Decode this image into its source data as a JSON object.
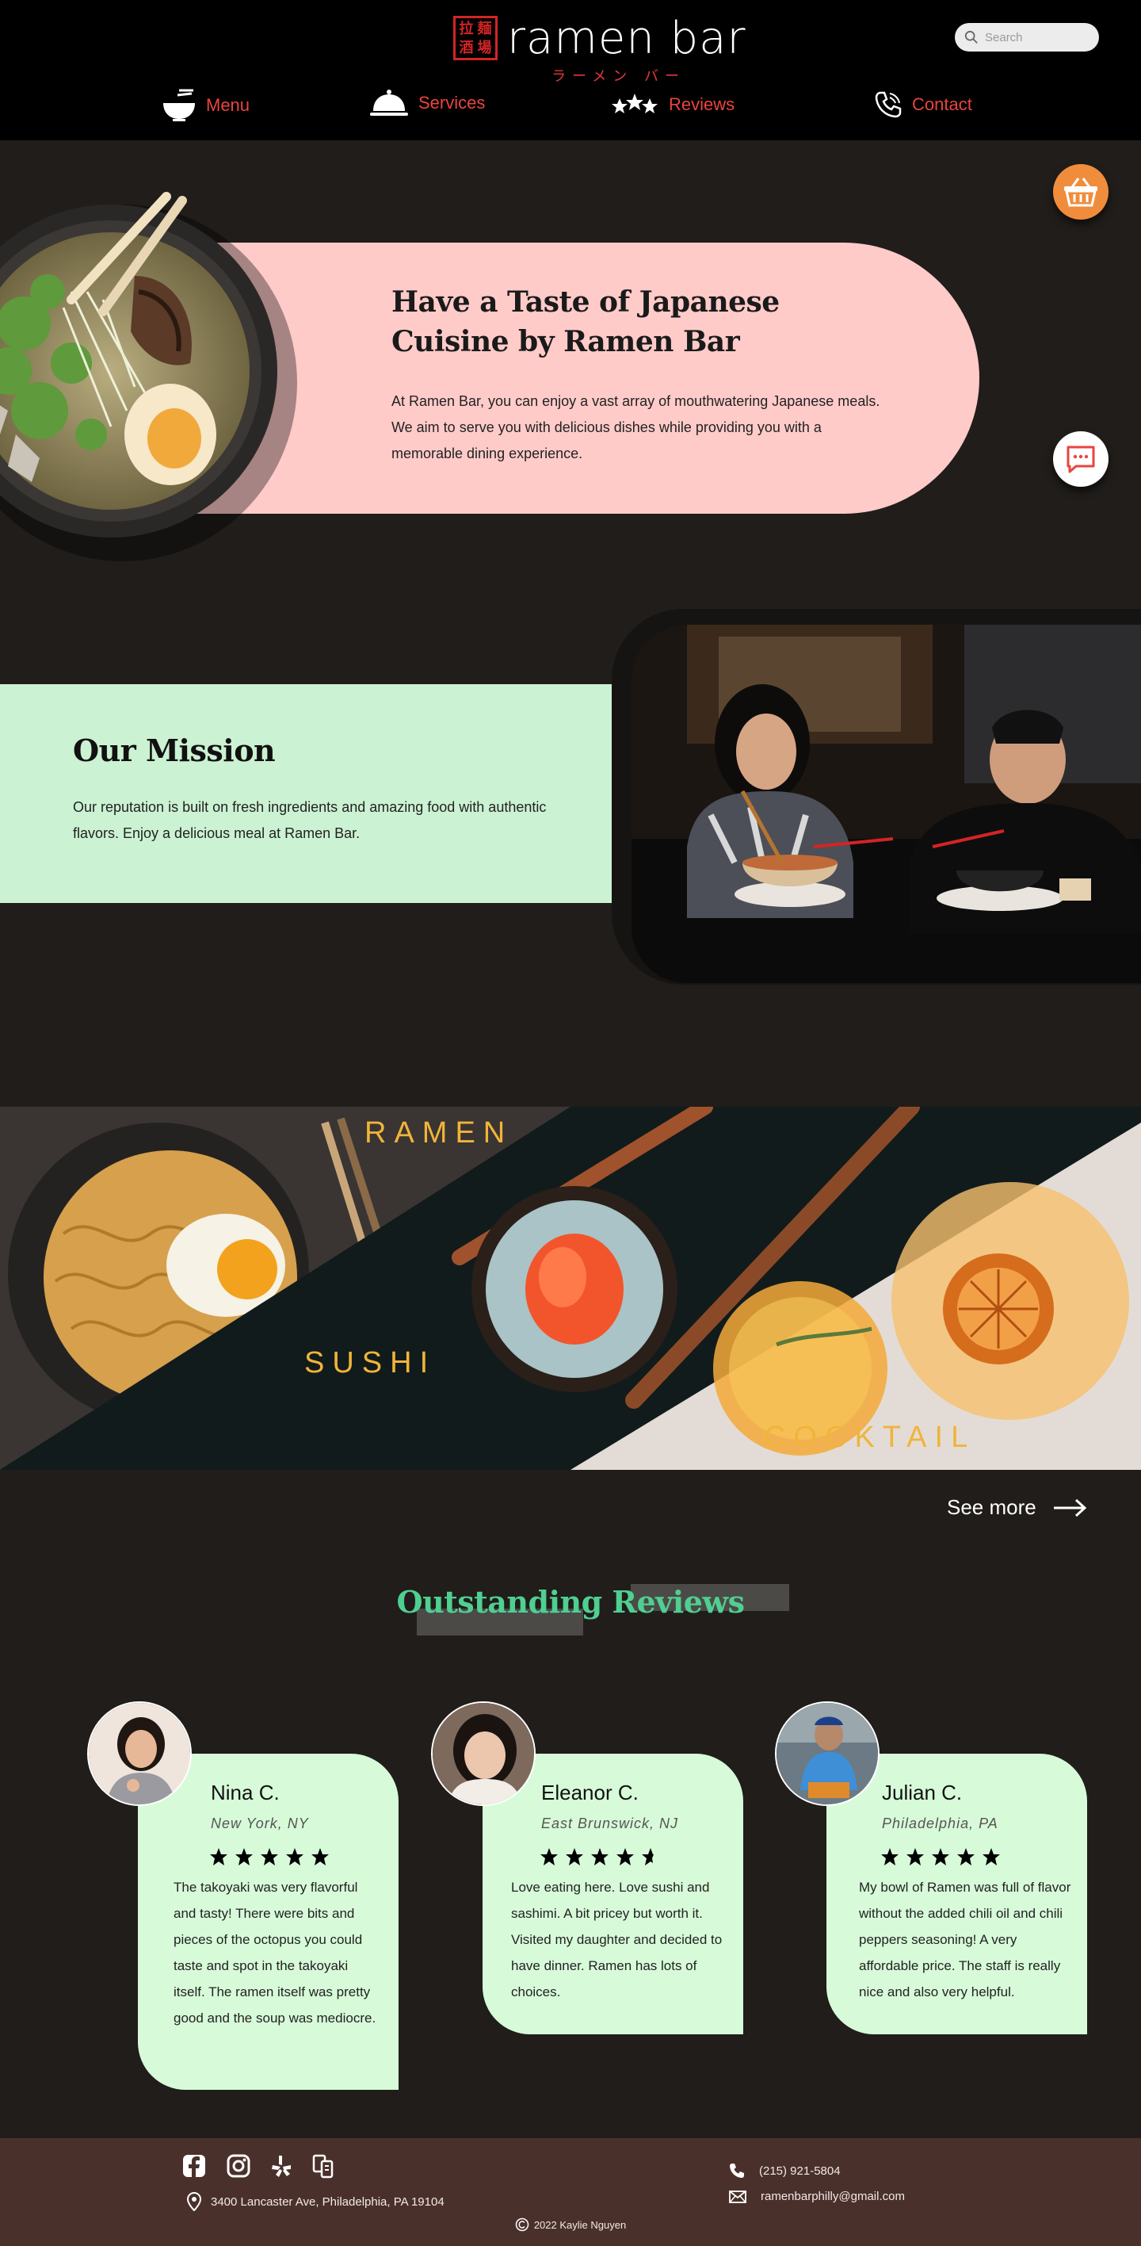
{
  "brand": {
    "name": "ramen bar",
    "subtitle": "ラーメン バー",
    "seal": [
      "拉",
      "麺",
      "酒",
      "場"
    ]
  },
  "search": {
    "placeholder": "Search"
  },
  "nav": {
    "menu": "Menu",
    "services": "Services",
    "reviews": "Reviews",
    "contact": "Contact"
  },
  "hero": {
    "title": "Have a Taste of Japanese Cuisine by Ramen Bar",
    "text": "At Ramen Bar, you can enjoy a vast array of mouthwatering Japanese meals. We aim to serve you with delicious dishes while providing you with a memorable dining experience."
  },
  "mission": {
    "title": "Our Mission",
    "text": "Our reputation is built on fresh ingredients and amazing food with authentic flavors. Enjoy a delicious meal at Ramen Bar."
  },
  "banner": {
    "ramen": "RAMEN",
    "sushi": "SUSHI",
    "cocktail": "COCKTAIL"
  },
  "see_more": "See more",
  "reviews": {
    "title": "Outstanding Reviews",
    "items": [
      {
        "name": "Nina C.",
        "location": "New York, NY",
        "rating": 5,
        "text": "The takoyaki was very flavorful and tasty! There were bits and pieces of the octopus you could taste and spot in the takoyaki itself. The ramen itself was pretty good and the soup was mediocre."
      },
      {
        "name": "Eleanor C.",
        "location": "East Brunswick, NJ",
        "rating": 4.5,
        "text": "Love eating here. Love sushi and sashimi. A bit pricey but worth it. Visited my daughter and decided to have dinner. Ramen has lots of choices."
      },
      {
        "name": "Julian C.",
        "location": "Philadelphia, PA",
        "rating": 5,
        "text": "My bowl of Ramen was full of flavor without the added chili oil and chili peppers seasoning! A very affordable price. The staff is really nice and also very helpful."
      }
    ]
  },
  "footer": {
    "address": "3400 Lancaster Ave, Philadelphia, PA 19104",
    "phone": "(215) 921-5804",
    "email": "ramenbarphilly@gmail.com",
    "copyright": "2022 Kaylie Nguyen",
    "social": [
      "facebook-icon",
      "instagram-icon",
      "yelp-icon",
      "grubhub-icon"
    ]
  },
  "colors": {
    "header_bg": "#000000",
    "page_bg": "#201d1a",
    "nav_accent": "#e8453c",
    "hero_pill": "#ffcbc9",
    "mission_band": "#cbf2d2",
    "review_card": "#d7fbd9",
    "reviews_title": "#4fcf91",
    "banner_label": "#f0b43a",
    "cart_fab": "#f08d3c",
    "footer_bg": "#4a302b"
  }
}
